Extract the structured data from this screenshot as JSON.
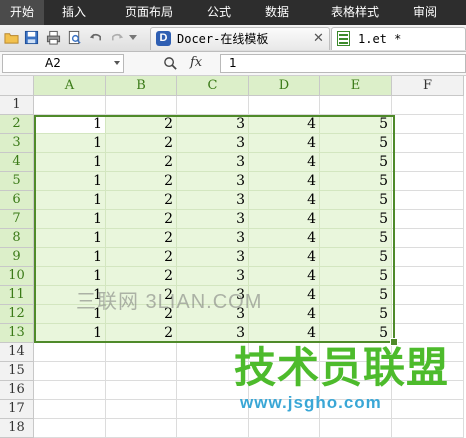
{
  "ribbon": {
    "tabs": [
      "开始",
      "插入",
      "页面布局",
      "公式",
      "数据",
      "表格样式",
      "审阅"
    ],
    "active_index": 0
  },
  "toolbar": {
    "icons": [
      "open-folder-icon",
      "save-icon",
      "print-icon",
      "print-preview-icon",
      "undo-icon",
      "redo-icon"
    ],
    "doc_tabs": [
      {
        "label": "Docer-在线模板",
        "icon": "docer-icon"
      },
      {
        "label": "1.et *",
        "icon": "spreadsheet-icon",
        "active": true
      }
    ]
  },
  "formula_bar": {
    "name_box": "A2",
    "fx_label": "fx",
    "value": "1"
  },
  "sheet": {
    "columns": [
      "A",
      "B",
      "C",
      "D",
      "E",
      "F"
    ],
    "rows": [
      "1",
      "2",
      "3",
      "4",
      "5",
      "6",
      "7",
      "8",
      "9",
      "10",
      "11",
      "12",
      "13",
      "14",
      "15",
      "16",
      "17",
      "18"
    ],
    "data": [
      [
        "",
        "",
        "",
        "",
        ""
      ],
      [
        "1",
        "2",
        "3",
        "4",
        "5"
      ],
      [
        "1",
        "2",
        "3",
        "4",
        "5"
      ],
      [
        "1",
        "2",
        "3",
        "4",
        "5"
      ],
      [
        "1",
        "2",
        "3",
        "4",
        "5"
      ],
      [
        "1",
        "2",
        "3",
        "4",
        "5"
      ],
      [
        "1",
        "2",
        "3",
        "4",
        "5"
      ],
      [
        "1",
        "2",
        "3",
        "4",
        "5"
      ],
      [
        "1",
        "2",
        "3",
        "4",
        "5"
      ],
      [
        "1",
        "2",
        "3",
        "4",
        "5"
      ],
      [
        "1",
        "2",
        "3",
        "4",
        "5"
      ],
      [
        "1",
        "2",
        "3",
        "4",
        "5"
      ],
      [
        "1",
        "2",
        "3",
        "4",
        "5"
      ]
    ],
    "selection": "A2:E13",
    "active_cell": "A2"
  },
  "watermarks": {
    "center_text": "三联网 3LIAN.COM",
    "logo_text": "技术员联盟",
    "logo_url": "www.jsgho.com"
  },
  "colors": {
    "ribbon_bg": "#2d2d2d",
    "selection_border": "#4f8a2a",
    "selection_fill": "#e9f6dc",
    "header_selected": "#dcefc9",
    "logo_green": "#4dbb2c",
    "logo_blue": "#3aa7d6"
  }
}
